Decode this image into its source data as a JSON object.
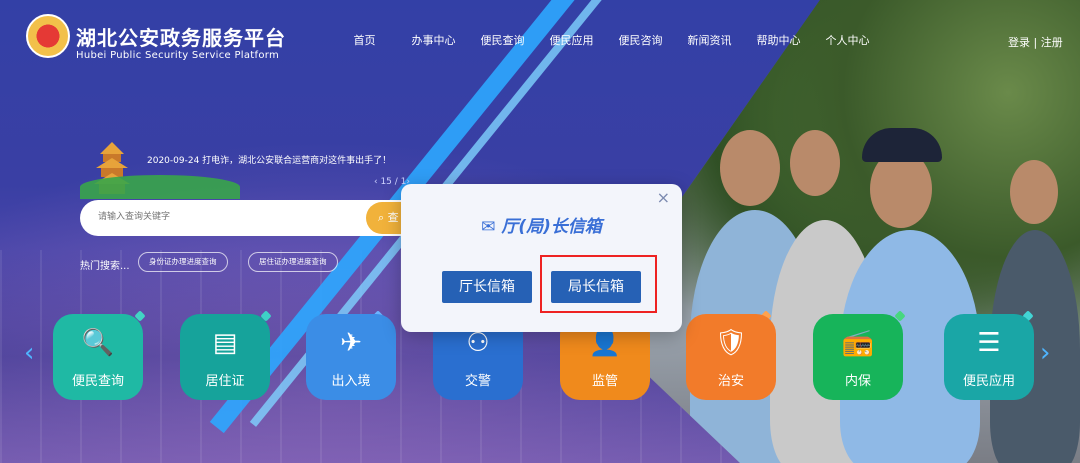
{
  "header": {
    "title": "湖北公安政务服务平台",
    "subtitle": "Hubei Public Security Service Platform",
    "nav": [
      "首页",
      "办事中心",
      "便民查询",
      "便民应用",
      "便民咨询",
      "新闻资讯",
      "帮助中心",
      "个人中心"
    ],
    "login": "登录 | 注册"
  },
  "news": {
    "text": "2020-09-24  打电诈，湖北公安联合运营商对这件事出手了！",
    "pager": "‹ 15 / 1›"
  },
  "search": {
    "placeholder": "请输入查询关键字",
    "button": "查"
  },
  "hot": {
    "label": "热门搜索...",
    "tags": [
      "身份证办理进度查询",
      "居住证办理进度查询"
    ]
  },
  "services": [
    {
      "label": "便民查询",
      "icon": "search-doc-icon",
      "color": "#1fb9a4"
    },
    {
      "label": "居住证",
      "icon": "card-icon",
      "color": "#16a39b"
    },
    {
      "label": "出入境",
      "icon": "plane-icon",
      "color": "#3b8de6"
    },
    {
      "label": "交警",
      "icon": "traffic-light-icon",
      "color": "#2a6fd0"
    },
    {
      "label": "监管",
      "icon": "person-icon",
      "color": "#f08a1c"
    },
    {
      "label": "治安",
      "icon": "shield-icon",
      "color": "#f27b2a"
    },
    {
      "label": "内保",
      "icon": "radio-icon",
      "color": "#17b45a"
    },
    {
      "label": "便民应用",
      "icon": "list-icon",
      "color": "#1aa6a6"
    }
  ],
  "modal": {
    "title": "厅(局)长信箱",
    "btn_director_hall": "厅长信箱",
    "btn_director_bureau": "局长信箱",
    "close": "×"
  }
}
